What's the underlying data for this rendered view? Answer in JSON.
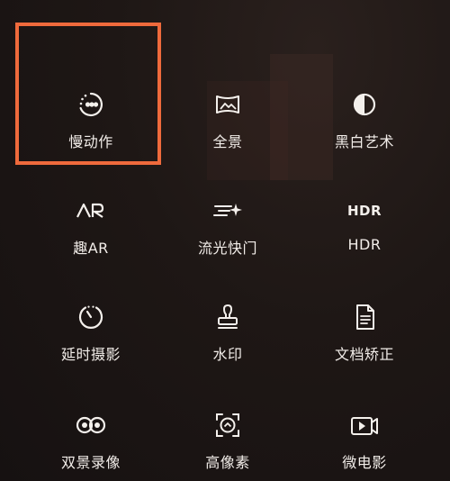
{
  "modes": [
    {
      "icon": "slow-motion-icon",
      "label": "慢动作",
      "selected": true
    },
    {
      "icon": "panorama-icon",
      "label": "全景",
      "selected": false
    },
    {
      "icon": "monochrome-icon",
      "label": "黑白艺术",
      "selected": false
    },
    {
      "icon": "ar-icon",
      "icon_text": "AR",
      "label": "趣AR",
      "selected": false
    },
    {
      "icon": "light-trail-icon",
      "label": "流光快门",
      "selected": false
    },
    {
      "icon": "hdr-icon",
      "icon_text": "HDR",
      "label": "HDR",
      "selected": false
    },
    {
      "icon": "timelapse-icon",
      "label": "延时摄影",
      "selected": false
    },
    {
      "icon": "watermark-stamp-icon",
      "label": "水印",
      "selected": false
    },
    {
      "icon": "document-scan-icon",
      "label": "文档矫正",
      "selected": false
    },
    {
      "icon": "dual-view-icon",
      "label": "双景录像",
      "selected": false
    },
    {
      "icon": "high-resolution-icon",
      "label": "高像素",
      "selected": false
    },
    {
      "icon": "micro-movie-icon",
      "label": "微电影",
      "selected": false
    }
  ],
  "colors": {
    "highlight": "#ef6a3c",
    "text": "#f2ede9",
    "background": "#1e1715"
  }
}
